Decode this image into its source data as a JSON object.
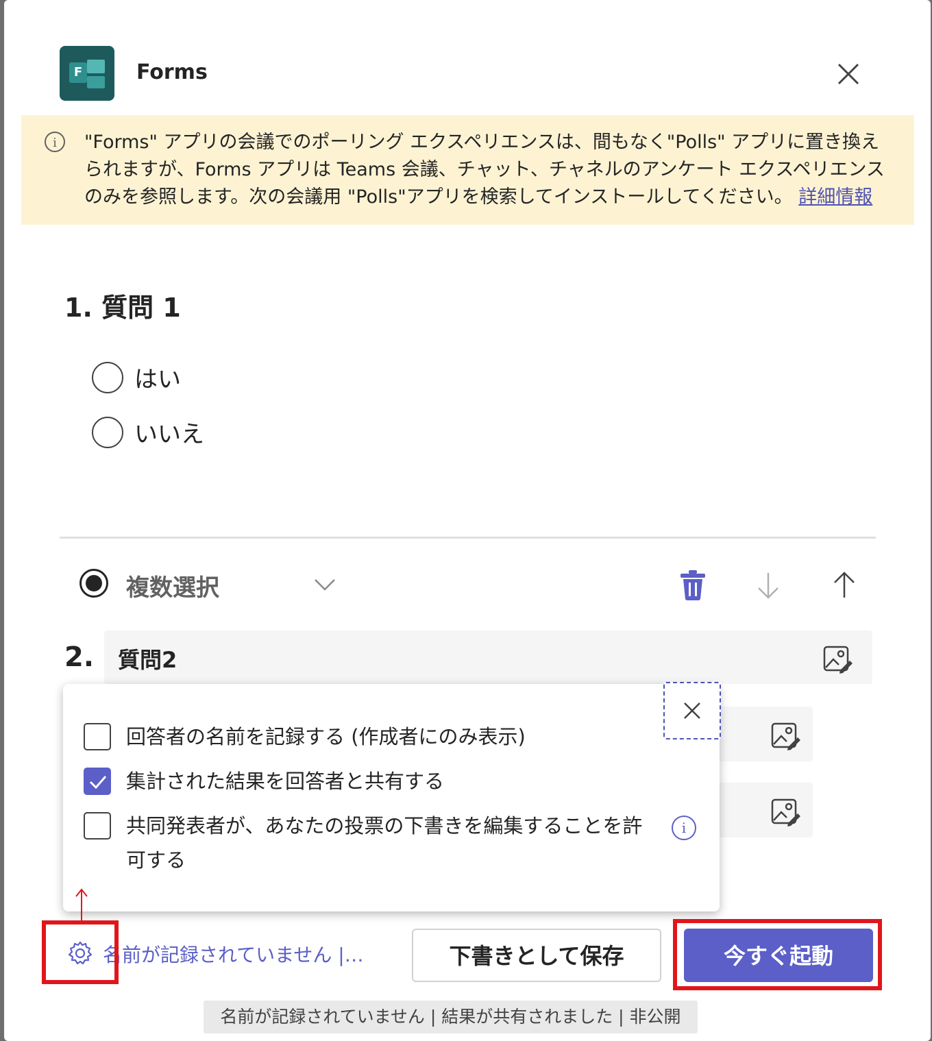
{
  "header": {
    "app_title": "Forms",
    "close_icon": "close-icon",
    "app_icon": "forms-app-icon"
  },
  "banner": {
    "message": "\"Forms\" アプリの会議でのポーリング エクスペリエンスは、間もなく\"Polls\" アプリに置き換えられますが、Forms アプリは Teams 会議、チャット、チャネルのアンケート エクスペリエンスのみを参照します。次の会議用 \"Polls\"アプリを検索してインストールしてください。",
    "link_label": "詳細情報",
    "icon": "info-icon",
    "background": "#fdf3d3"
  },
  "question1": {
    "title": "1. 質問 1",
    "options": [
      "はい",
      "いいえ"
    ]
  },
  "question2": {
    "type_label": "複数選択",
    "number": "2.",
    "text": "質問2",
    "toolbar_icons": [
      "chevron-down-icon",
      "trash-icon",
      "arrow-down-icon",
      "arrow-up-icon"
    ]
  },
  "settings_popup": {
    "options": [
      {
        "label": "回答者の名前を記録する (作成者にのみ表示)",
        "checked": false
      },
      {
        "label": "集計された結果を回答者と共有する",
        "checked": true
      },
      {
        "label": "共同発表者が、あなたの投票の下書きを編集することを許可する",
        "checked": false
      }
    ]
  },
  "footer": {
    "settings_summary": "名前が記録されていません |…",
    "save_draft_label": "下書きとして保存",
    "launch_label": "今すぐ起動",
    "tooltip": "名前が記録されていません | 結果が共有されました | 非公開"
  },
  "colors": {
    "accent": "#5b5fc7",
    "highlight": "#e0161b"
  }
}
